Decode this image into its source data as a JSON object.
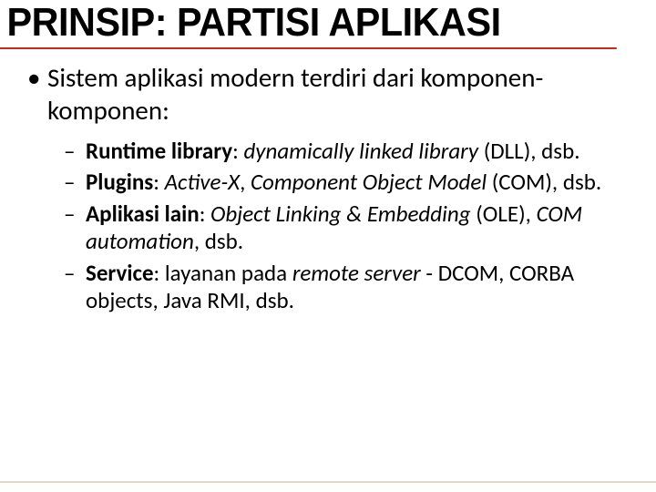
{
  "title": "PRINSIP: PARTISI APLIKASI",
  "intro": "Sistem aplikasi modern terdiri dari komponen-komponen:",
  "items": [
    {
      "label": "Runtime library",
      "rest_html": ": <span class=\"i\">dynamically linked library</span> (DLL), dsb."
    },
    {
      "label": "Plugins",
      "rest_html": ": <span class=\"i\">Active-X</span>, <span class=\"i\">Component Object Model</span> (COM), dsb."
    },
    {
      "label": "Aplikasi lain",
      "rest_html": ": <span class=\"i\">Object Linking &amp; Embedding</span> (OLE), <span class=\"i\">COM automation</span>, dsb."
    },
    {
      "label": "Service",
      "rest_html": ": layanan pada <span class=\"i\">remote server</span> - DCOM, CORBA objects, Java RMI, dsb."
    }
  ]
}
